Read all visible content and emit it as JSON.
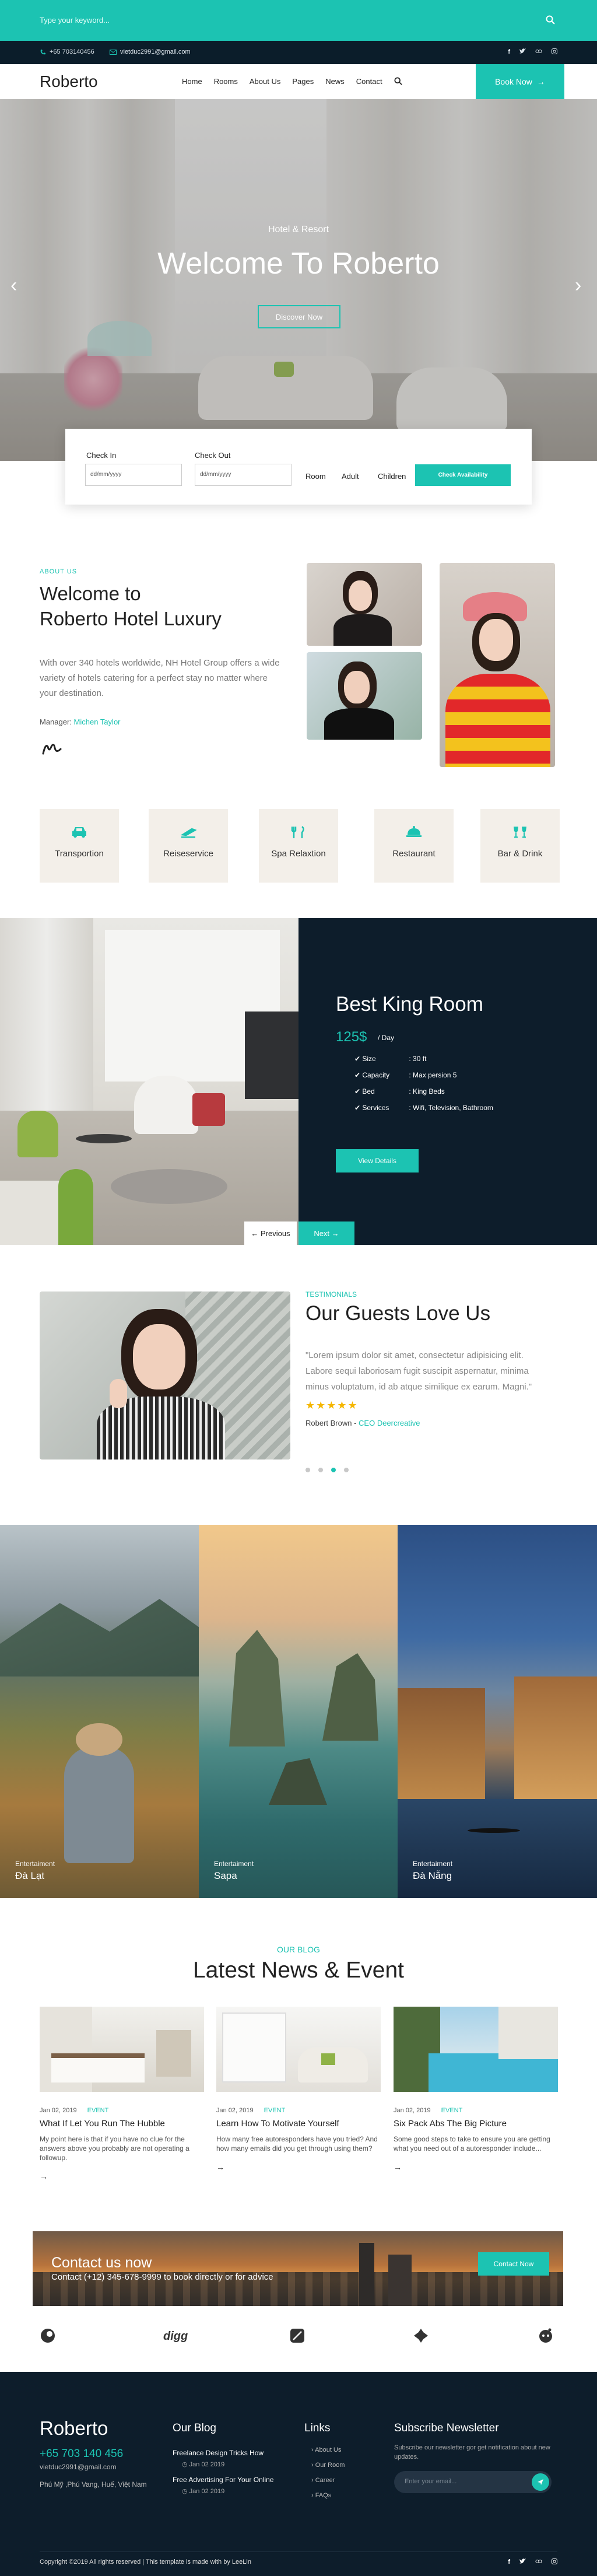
{
  "search": {
    "placeholder": "Type your keyword..."
  },
  "contact": {
    "phone": "+65 703140456",
    "email": "vietduc2991@gmail.com"
  },
  "nav": {
    "logo": "Roberto",
    "items": [
      "Home",
      "Rooms",
      "About Us",
      "Pages",
      "News",
      "Contact"
    ],
    "book_label": "Book Now"
  },
  "hero": {
    "subtitle": "Hotel & Resort",
    "title": "Welcome To Roberto",
    "button": "Discover Now"
  },
  "booking": {
    "checkin_label": "Check In",
    "checkout_label": "Check Out",
    "date_placeholder": "dd/mm/yyyy",
    "room_label": "Room",
    "adult_label": "Adult",
    "children_label": "Children",
    "button": "Check Availability"
  },
  "about": {
    "eyebrow": "ABOUT US",
    "heading_line1": "Welcome to",
    "heading_line2": "Roberto Hotel Luxury",
    "paragraph": "With over 340 hotels worldwide, NH Hotel Group offers a wide variety of hotels catering for a perfect stay no matter where your destination.",
    "manager_label": "Manager:",
    "manager_name": "Michen Taylor"
  },
  "services": [
    {
      "label": "Transportion",
      "icon": "car-icon"
    },
    {
      "label": "Reiseservice",
      "icon": "plane-icon"
    },
    {
      "label": "Spa Relaxtion",
      "icon": "spa-icon"
    },
    {
      "label": "Restaurant",
      "icon": "cloche-icon"
    },
    {
      "label": "Bar & Drink",
      "icon": "glasses-icon"
    }
  ],
  "room": {
    "title": "Best King Room",
    "price": "125$",
    "per": "/ Day",
    "specs": [
      {
        "k": "Size",
        "v": ": 30 ft"
      },
      {
        "k": "Capacity",
        "v": ": Max persion 5"
      },
      {
        "k": "Bed",
        "v": ": King Beds"
      },
      {
        "k": "Services",
        "v": ": Wifi, Television, Bathroom"
      }
    ],
    "button": "View Details",
    "prev": "Previous",
    "next": "Next"
  },
  "testimonial": {
    "eyebrow": "TESTIMONIALS",
    "title": "Our Guests Love Us",
    "quote": "\"Lorem ipsum dolor sit amet, consectetur adipisicing elit. Labore sequi laboriosam fugit suscipit aspernatur, minima minus voluptatum, id ab atque similique ex earum. Magni.\"",
    "stars": "★★★★★",
    "author": "Robert Brown",
    "role": "CEO Deercreative"
  },
  "destinations": [
    {
      "category": "Entertaiment",
      "name": "Đà Lạt"
    },
    {
      "category": "Entertaiment",
      "name": "Sapa"
    },
    {
      "category": "Entertaiment",
      "name": "Đà Nẵng"
    }
  ],
  "blog": {
    "eyebrow": "OUR BLOG",
    "title": "Latest News & Event",
    "posts": [
      {
        "date": "Jan 02, 2019",
        "cat": "EVENT",
        "title": "What If Let You Run The Hubble",
        "desc": "My point here is that if you have no clue for the answers above you probably are not operating a followup."
      },
      {
        "date": "Jan 02, 2019",
        "cat": "EVENT",
        "title": "Learn How To Motivate Yourself",
        "desc": "How many free autoresponders have you tried? And how many emails did you get through using them?"
      },
      {
        "date": "Jan 02, 2019",
        "cat": "EVENT",
        "title": "Six Pack Abs The Big Picture",
        "desc": "Some good steps to take to ensure you are getting what you need out of a autoresponder include..."
      }
    ]
  },
  "banner": {
    "title": "Contact us now",
    "subtitle": "Contact (+12) 345-678-9999 to book directly or for advice",
    "button": "Contact Now"
  },
  "partners": [
    "partner-1-icon",
    "digg",
    "partner-3-icon",
    "partner-4-icon",
    "reddit-icon"
  ],
  "footer": {
    "logo": "Roberto",
    "phone": "+65 703 140 456",
    "email": "vietduc2991@gmail.com",
    "address": "Phú Mỹ ,Phú Vang, Huế, Việt Nam",
    "blog_heading": "Our Blog",
    "blog_posts": [
      {
        "title": "Freelance Design Tricks How",
        "date": "Jan 02 2019"
      },
      {
        "title": "Free Advertising For Your Online",
        "date": "Jan 02 2019"
      }
    ],
    "links_heading": "Links",
    "links": [
      "About Us",
      "Our Room",
      "Career",
      "FAQs"
    ],
    "newsletter_heading": "Subscribe Newsletter",
    "newsletter_text": "Subscribe our newsletter gor get notification about new updates.",
    "email_placeholder": "Enter your email...",
    "copyright": "Copyright ©2019 All rights reserved | This template is made with by LeeLin"
  },
  "colors": {
    "accent": "#1cc3b2",
    "dark": "#0d1d2b"
  }
}
